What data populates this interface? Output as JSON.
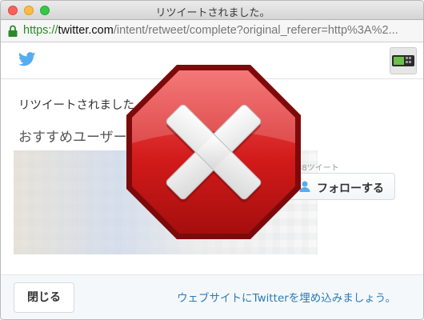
{
  "window": {
    "title": "リツイートされました。"
  },
  "address_bar": {
    "scheme": "https://",
    "host": "twitter.com",
    "path": "/intent/retweet/complete?original_referer=http%3A%2..."
  },
  "header": {
    "logo_icon": "twitter-bird-icon",
    "avatar_icon": "user-avatar"
  },
  "main": {
    "message": "リツイートされました。",
    "recommended_heading": "おすすめユーザー",
    "tweet_count": "38ツイート",
    "follow_button_label": "フォローする",
    "follow_icon": "user-icon"
  },
  "footer": {
    "close_button_label": "閉じる",
    "embed_link": "ウェブサイトにTwitterを埋め込みましょう。"
  },
  "overlay": {
    "icon": "error-stop-sign-icon",
    "color": "#d21a1a"
  },
  "colors": {
    "link": "#2b7bb9",
    "twitter_blue": "#55acee",
    "secure_green": "#2a8a2a"
  }
}
